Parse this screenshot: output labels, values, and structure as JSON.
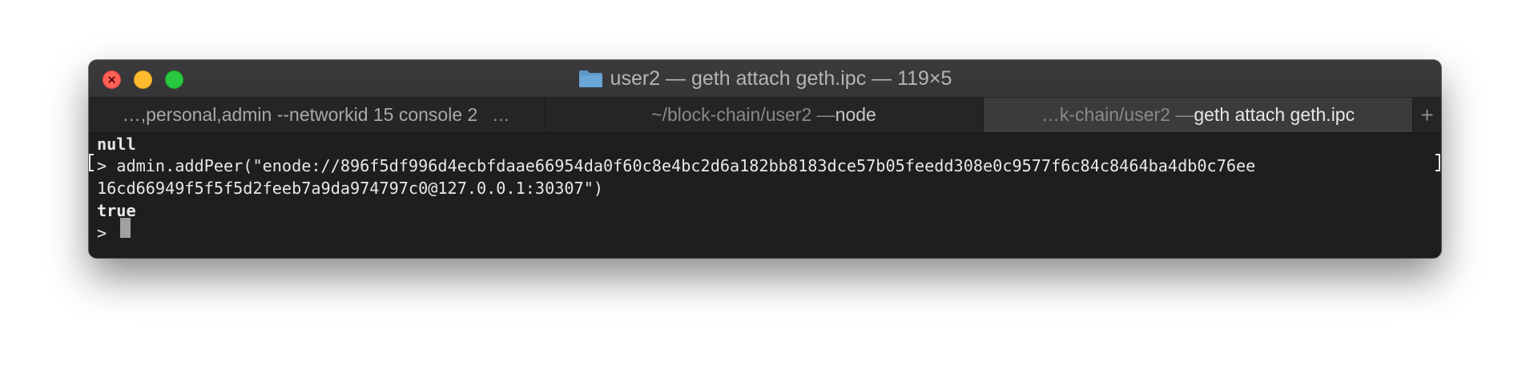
{
  "window": {
    "title": "user2 — geth attach geth.ipc — 119×5"
  },
  "tabs": [
    {
      "label": "…,personal,admin --networkid 15 console 2",
      "more": "…"
    },
    {
      "path": "~/block-chain/user2 — ",
      "process": "node"
    },
    {
      "path": "…k-chain/user2 — ",
      "process": "geth attach geth.ipc"
    }
  ],
  "new_tab_label": "+",
  "terminal": {
    "line1": "null",
    "line2": "> admin.addPeer(\"enode://896f5df996d4ecbfdaae66954da0f60c8e4bc2d6a182bb8183dce57b05feedd308e0c9577f6c84c8464ba4db0c76ee",
    "line3": "16cd66949f5f5f5d2feeb7a9da974797c0@127.0.0.1:30307\")",
    "line4": "true",
    "prompt": ">"
  },
  "colors": {
    "close": "#fe5f57",
    "minimize": "#febc2e",
    "zoom": "#28c840",
    "folder": "#6aa6d6"
  },
  "icons": {
    "title": "folder-icon",
    "close": "close-icon",
    "more": "ellipsis-icon",
    "new_tab": "plus-icon"
  }
}
